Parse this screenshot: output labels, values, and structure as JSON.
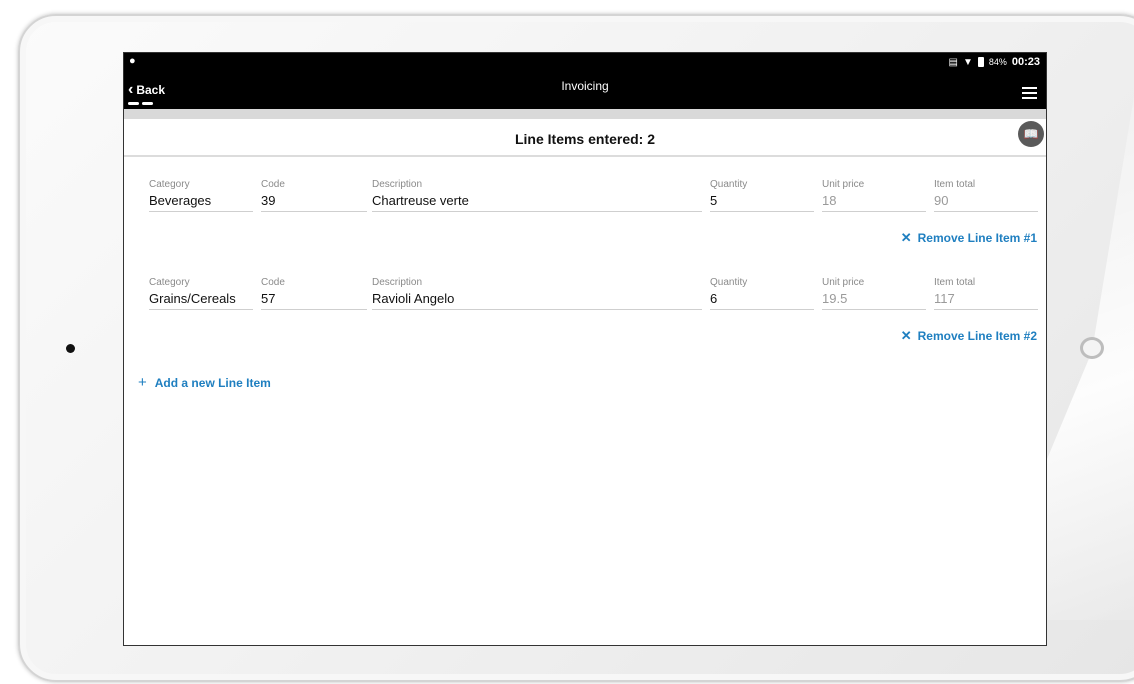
{
  "status_bar": {
    "battery_pct": "84%",
    "time": "00:23"
  },
  "app_bar": {
    "back_label": "Back",
    "title": "Invoicing"
  },
  "header": {
    "title": "Line Items entered: 2"
  },
  "columns": {
    "category": "Category",
    "code": "Code",
    "description": "Description",
    "quantity": "Quantity",
    "unit_price": "Unit price",
    "item_total": "Item total"
  },
  "line_items": [
    {
      "category": "Beverages",
      "code": "39",
      "description": "Chartreuse verte",
      "quantity": "5",
      "unit_price": "18",
      "item_total": "90",
      "remove_label": "Remove Line Item #1"
    },
    {
      "category": "Grains/Cereals",
      "code": "57",
      "description": "Ravioli Angelo",
      "quantity": "6",
      "unit_price": "19.5",
      "item_total": "117",
      "remove_label": "Remove Line Item #2"
    }
  ],
  "add_label": "Add a new Line Item",
  "colors": {
    "accent": "#1f7fc0",
    "app_bar": "#000000"
  }
}
